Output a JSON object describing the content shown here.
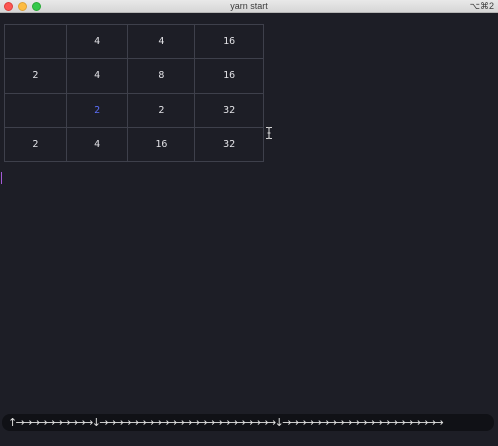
{
  "window": {
    "title": "yarn start",
    "shortcut": "⌥⌘2"
  },
  "board": {
    "rows": [
      [
        "",
        "4",
        "4",
        "16"
      ],
      [
        "2",
        "4",
        "8",
        "16"
      ],
      [
        "",
        "2",
        "2",
        "32"
      ],
      [
        "2",
        "4",
        "16",
        "32"
      ]
    ],
    "new_tile": {
      "row": 2,
      "col": 1
    },
    "colors": {
      "tile_text": "#e2e2e6",
      "new_tile_text": "#5b6ef5",
      "grid_line": "#3e404b"
    }
  },
  "caret": {
    "color": "#a45ad6"
  },
  "moves": {
    "text": "↑→→→→→→→→→→↓→→→→→→→→→→→→→→→→→→→→→→→↓→→→→→→→→→→→→→→→→→→→→→"
  }
}
